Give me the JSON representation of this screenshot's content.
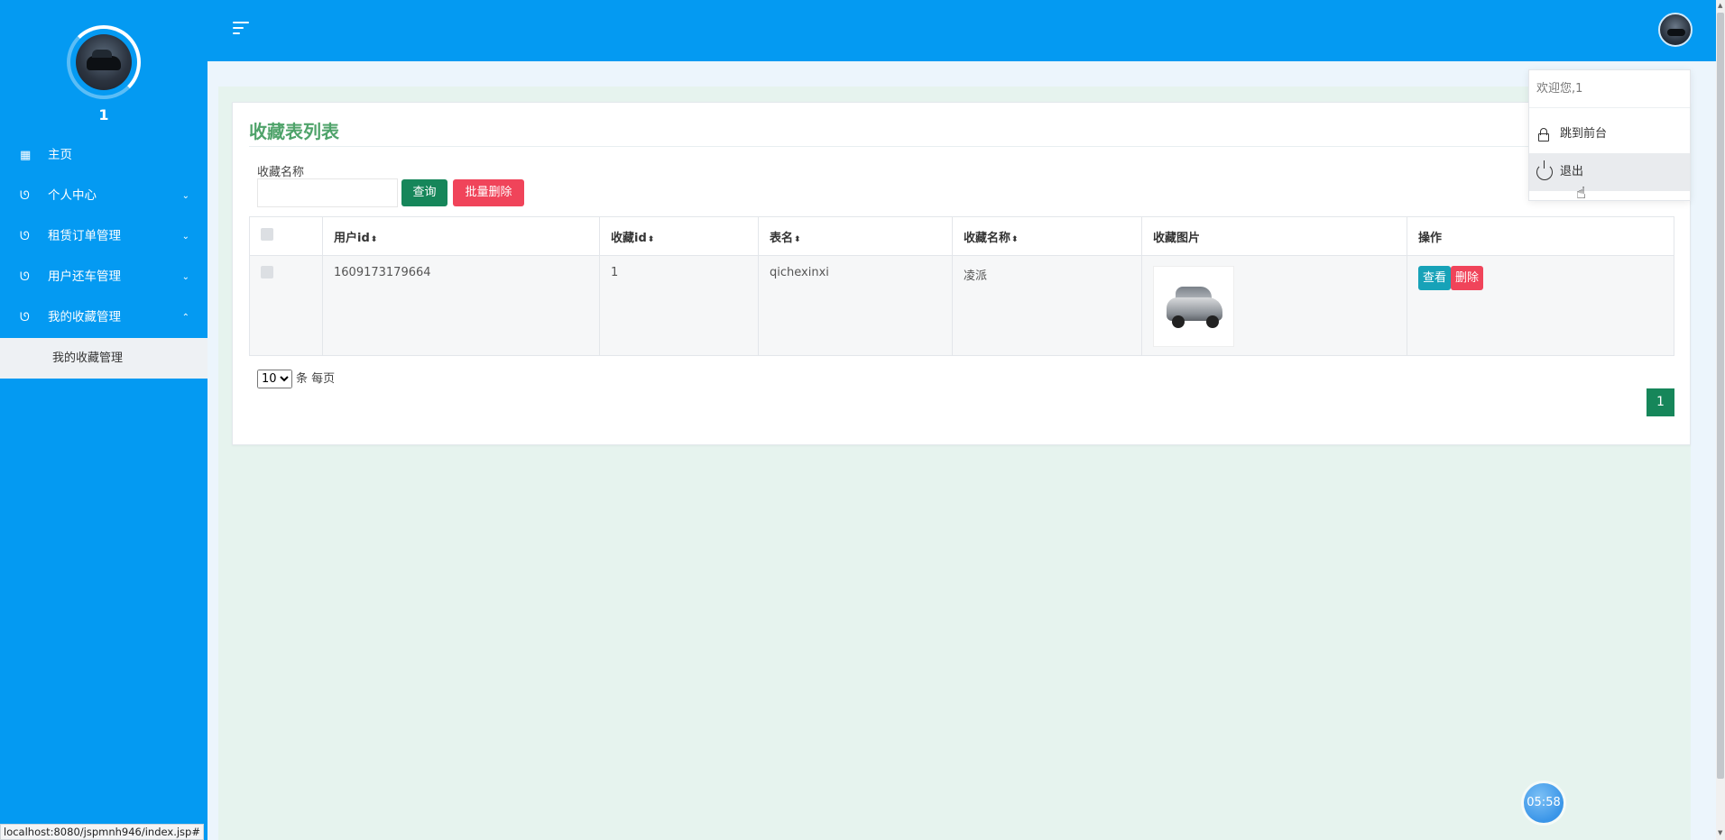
{
  "sidebar": {
    "username": "1",
    "items": [
      {
        "label": "主页",
        "icon": "grid-icon",
        "chevron": ""
      },
      {
        "label": "个人中心",
        "icon": "stethoscope-icon",
        "chevron": "⌄"
      },
      {
        "label": "租赁订单管理",
        "icon": "stethoscope-icon",
        "chevron": "⌄"
      },
      {
        "label": "用户还车管理",
        "icon": "stethoscope-icon",
        "chevron": "⌄"
      },
      {
        "label": "我的收藏管理",
        "icon": "stethoscope-icon",
        "chevron": "⌃"
      }
    ],
    "sub_item": "我的收藏管理"
  },
  "header": {
    "menu_toggle_icon": "menu-toggle-icon",
    "avatar_icon": "user-avatar"
  },
  "main": {
    "title": "收藏表列表",
    "search": {
      "label": "收藏名称",
      "value": "",
      "placeholder": ""
    },
    "buttons": {
      "query": "查询",
      "batch_delete": "批量删除"
    },
    "table": {
      "columns": [
        "用户id",
        "收藏id",
        "表名",
        "收藏名称",
        "收藏图片",
        "操作"
      ],
      "sort_glyph": "⬍",
      "rows": [
        {
          "user_id": "1609173179664",
          "fav_id": "1",
          "table_name": "qichexinxi",
          "fav_name": "凌派",
          "image": "car-thumbnail",
          "actions": {
            "view": "查看",
            "delete": "删除"
          }
        }
      ]
    },
    "pagination": {
      "page_size": "10",
      "page_size_suffix": "条 每页",
      "current_page": "1"
    }
  },
  "dropdown": {
    "welcome": "欢迎您,1",
    "items": [
      {
        "label": "跳到前台",
        "icon": "lock-icon"
      },
      {
        "label": "退出",
        "icon": "power-icon"
      }
    ]
  },
  "timer": "05:58",
  "statusbar": "localhost:8080/jspmnh946/index.jsp#",
  "colors": {
    "primary_blue": "#049af2",
    "title_green": "#4fa36a",
    "button_green": "#16865a",
    "danger_red": "#f0445a",
    "info_teal": "#17a2b8"
  }
}
